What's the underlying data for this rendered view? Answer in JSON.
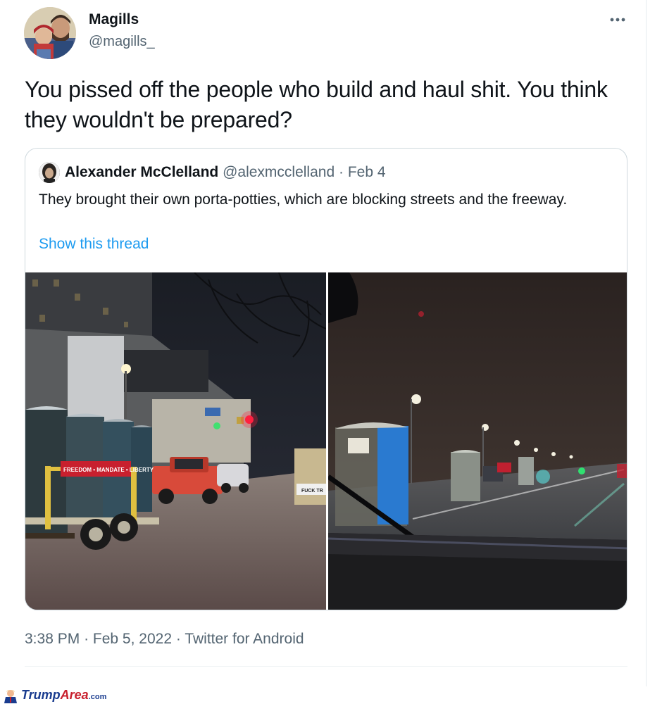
{
  "author": {
    "name": "Magills",
    "handle": "@magills_"
  },
  "tweet": {
    "text": "You pissed off the people who build and haul shit. You think they wouldn't be prepared?",
    "time": "3:38 PM",
    "date": "Feb 5, 2022",
    "source": "Twitter for Android",
    "separator": "·"
  },
  "quoted": {
    "name": "Alexander McClelland",
    "handle": "@alexmcclelland",
    "separator": "·",
    "date": "Feb 4",
    "text": "They brought their own porta-potties, which are blocking streets and the freeway.",
    "show_thread": "Show this thread",
    "photo1_sign": "FREEDOM • MANDATE • LIBERTY",
    "photo1_tag": "FUCK TR"
  },
  "icons": {
    "more": "more-horizontal-icon"
  },
  "watermark": {
    "part1": "Trump",
    "part2": "Area",
    "part3": ".com"
  },
  "colors": {
    "link": "#1d9bf0",
    "secondary_text": "#536471",
    "primary_text": "#0f1419",
    "border": "#cfd9de"
  }
}
